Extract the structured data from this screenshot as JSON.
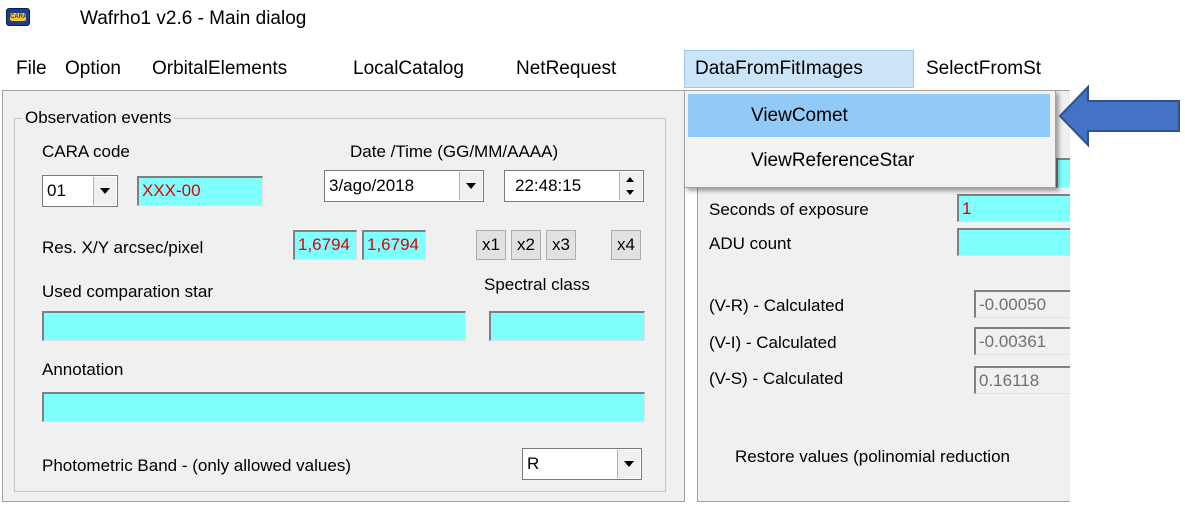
{
  "window": {
    "title": "Wafrho1 v2.6 - Main dialog",
    "icon": "cara-logo-icon",
    "icon_text": "CARA"
  },
  "menu": {
    "items": [
      "File",
      "Option",
      "OrbitalElements",
      "LocalCatalog",
      "NetRequest",
      "DataFromFitImages",
      "SelectFromSt"
    ],
    "active": "DataFromFitImages",
    "dropdown": [
      "ViewComet",
      "ViewReferenceStar"
    ],
    "highlighted": "ViewComet"
  },
  "observation": {
    "group_title": "Observation events",
    "cara_code_label": "CARA code",
    "cara_code_value": "01",
    "cara_id_value": "XXX-00",
    "datetime_label": "Date /Time  (GG/MM/AAAA)",
    "date_value": "3/ago/2018",
    "time_value": "22:48:15",
    "res_label": "Res. X/Y arcsec/pixel",
    "res_x": "1,6794",
    "res_y": "1,6794",
    "buttons": [
      "x1",
      "x2",
      "x3",
      "x4"
    ],
    "comparison_star_label": "Used comparation star",
    "spectral_class_label": "Spectral class",
    "comparison_star_value": "",
    "spectral_class_value": "",
    "annotation_label": "Annotation",
    "annotation_value": "",
    "band_label": "Photometric Band  - (only allowed values)",
    "band_value": "R"
  },
  "right_panel": {
    "exposure_label": "Seconds of exposure",
    "exposure_value": "1",
    "adu_label": "ADU count",
    "adu_value": "",
    "vr_label": "(V-R) - Calculated",
    "vr_value": "-0.00050",
    "vi_label": "(V-I) -  Calculated",
    "vi_value": "-0.00361",
    "vs_label": "(V-S) - Calculated",
    "vs_value": "0.16118",
    "restore_label": "Restore values (polinomial reduction"
  },
  "colors": {
    "field_cyan": "#80ffff",
    "menu_highlight": "#cce4f7",
    "dropdown_highlight": "#91c9f7",
    "arrow_fill": "#4472c4",
    "red_text": "#e00000"
  }
}
